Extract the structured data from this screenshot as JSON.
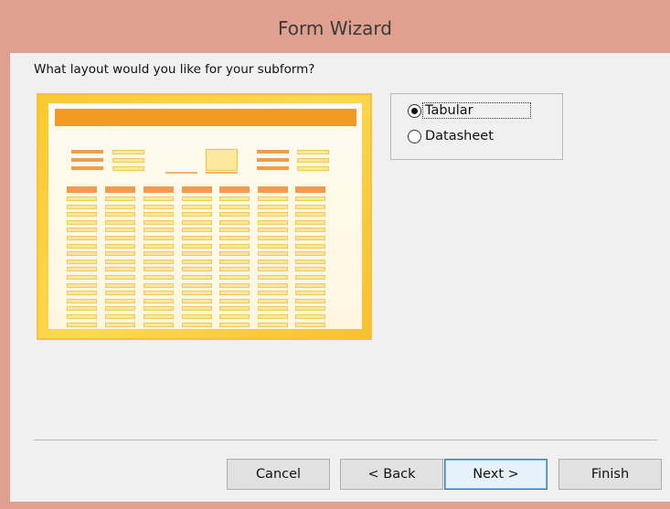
{
  "window": {
    "title": "Form Wizard"
  },
  "prompt": "What layout would you like for your subform?",
  "layout_options": [
    {
      "label": "Tabular",
      "selected": true
    },
    {
      "label": "Datasheet",
      "selected": false
    }
  ],
  "buttons": {
    "cancel": "Cancel",
    "back": "< Back",
    "next": "Next >",
    "finish": "Finish"
  },
  "colors": {
    "titlebar": "#dfa08f",
    "preview_frame": "#f9c92f",
    "preview_header": "#f39a24",
    "default_button_border": "#3c7fb1"
  },
  "icons": [
    "tabular-layout-preview-image"
  ]
}
